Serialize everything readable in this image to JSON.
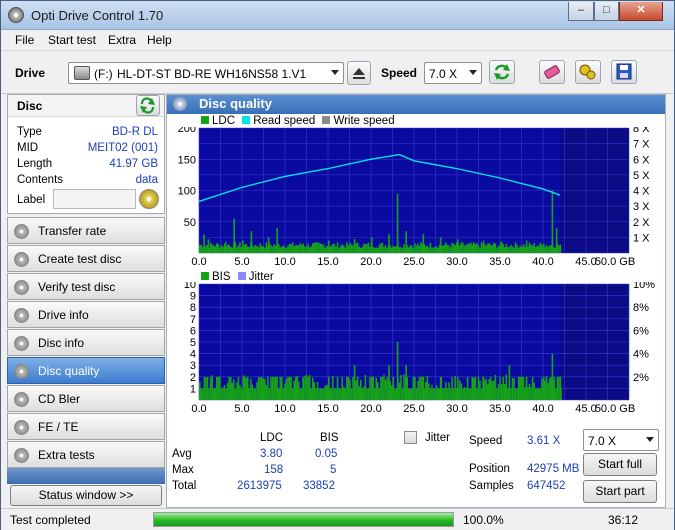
{
  "window": {
    "title": "Opti Drive Control 1.70",
    "min": "–",
    "max": "□",
    "close": "✕"
  },
  "menu": [
    "File",
    "Start test",
    "Extra",
    "Help"
  ],
  "toolbar": {
    "drive_label": "Drive",
    "drive_letter": "(F:)",
    "drive_name": "HL-DT-ST BD-RE  WH16NS58 1.V1",
    "speed_label": "Speed",
    "speed_value": "7.0 X"
  },
  "disc": {
    "title": "Disc",
    "type_label": "Type",
    "type": "BD-R DL",
    "mid_label": "MID",
    "mid": "MEIT02 (001)",
    "length_label": "Length",
    "length": "41.97 GB",
    "contents_label": "Contents",
    "contents": "data",
    "label_label": "Label",
    "label_value": ""
  },
  "nav": [
    "Transfer rate",
    "Create test disc",
    "Verify test disc",
    "Drive info",
    "Disc info",
    "Disc quality",
    "CD Bler",
    "FE / TE",
    "Extra tests"
  ],
  "status_window_button": "Status window >>",
  "panel": {
    "title": "Disc quality"
  },
  "legend_top": {
    "ldc": "LDC",
    "read": "Read speed",
    "write": "Write speed"
  },
  "legend_bottom": {
    "bis": "BIS",
    "jitter": "Jitter"
  },
  "colors": {
    "ldc": "#17a317",
    "read": "#00e5e5",
    "write": "#8a8a8a",
    "bis": "#17a317",
    "jitter": "#8a8aff",
    "plot_bg": "#0a0aa0",
    "accent": "#1c3fb5"
  },
  "chart_data": [
    {
      "type": "bar",
      "x_ticks": [
        "0.0",
        "5.0",
        "10.0",
        "15.0",
        "20.0",
        "25.0",
        "30.0",
        "35.0",
        "40.0",
        "45.0",
        "50.0 GB"
      ],
      "y_left_ticks": [
        "200",
        "150",
        "100",
        "50"
      ],
      "y_right_ticks": [
        "8 X",
        "7 X",
        "6 X",
        "5 X",
        "4 X",
        "3 X",
        "2 X",
        "1 X"
      ],
      "xlim": [
        0,
        50
      ],
      "ylim": [
        0,
        200
      ],
      "y2lim": [
        0,
        8
      ],
      "disc_end_gb": 42.0,
      "series": [
        {
          "name": "LDC",
          "values": [
            [
              0.5,
              30
            ],
            [
              1,
              22
            ],
            [
              3,
              18
            ],
            [
              4,
              55
            ],
            [
              5,
              20
            ],
            [
              6,
              35
            ],
            [
              8,
              25
            ],
            [
              9,
              40
            ],
            [
              12,
              15
            ],
            [
              15,
              20
            ],
            [
              18,
              22
            ],
            [
              20,
              25
            ],
            [
              22,
              30
            ],
            [
              23,
              95
            ],
            [
              24,
              35
            ],
            [
              26,
              30
            ],
            [
              28,
              25
            ],
            [
              30,
              22
            ],
            [
              33,
              20
            ],
            [
              35,
              18
            ],
            [
              38,
              20
            ],
            [
              40,
              15
            ],
            [
              41,
              100
            ],
            [
              41.5,
              40
            ]
          ]
        },
        {
          "name": "Read speed",
          "values": [
            [
              0,
              3.3
            ],
            [
              5,
              4.2
            ],
            [
              10,
              4.9
            ],
            [
              15,
              5.4
            ],
            [
              20,
              6.0
            ],
            [
              23.3,
              6.3
            ],
            [
              25,
              5.9
            ],
            [
              30,
              5.4
            ],
            [
              35,
              4.8
            ],
            [
              40,
              4.1
            ],
            [
              42,
              3.7
            ]
          ]
        }
      ]
    },
    {
      "type": "bar",
      "x_ticks": [
        "0.0",
        "5.0",
        "10.0",
        "15.0",
        "20.0",
        "25.0",
        "30.0",
        "35.0",
        "40.0",
        "45.0",
        "50.0 GB"
      ],
      "y_left_ticks": [
        "10",
        "9",
        "8",
        "7",
        "6",
        "5",
        "4",
        "3",
        "2",
        "1"
      ],
      "y_right_ticks": [
        "10%",
        "8%",
        "6%",
        "4%",
        "2%"
      ],
      "xlim": [
        0,
        50
      ],
      "ylim": [
        0,
        10
      ],
      "y2lim": [
        0,
        10
      ],
      "disc_end_gb": 42.0,
      "series": [
        {
          "name": "BIS",
          "values": [
            [
              0,
              1
            ],
            [
              5,
              1
            ],
            [
              10,
              1
            ],
            [
              12,
              2
            ],
            [
              15,
              2
            ],
            [
              18,
              3
            ],
            [
              20,
              2
            ],
            [
              22,
              3
            ],
            [
              23,
              5
            ],
            [
              24,
              3
            ],
            [
              26,
              2
            ],
            [
              28,
              2
            ],
            [
              30,
              2
            ],
            [
              33,
              2
            ],
            [
              36,
              3
            ],
            [
              38,
              2
            ],
            [
              40,
              2
            ],
            [
              41,
              4
            ],
            [
              42,
              1
            ]
          ]
        }
      ]
    }
  ],
  "stats": {
    "col_ldc": "LDC",
    "col_bis": "BIS",
    "avg_label": "Avg",
    "avg_ldc": "3.80",
    "avg_bis": "0.05",
    "max_label": "Max",
    "max_ldc": "158",
    "max_bis": "5",
    "total_label": "Total",
    "total_ldc": "2613975",
    "total_bis": "33852",
    "jitter_label": "Jitter",
    "speed_label": "Speed",
    "speed": "3.61 X",
    "speed_select": "7.0 X",
    "position_label": "Position",
    "position": "42975 MB",
    "samples_label": "Samples",
    "samples": "647452",
    "start_full": "Start full",
    "start_part": "Start part"
  },
  "status": {
    "text": "Test completed",
    "progress": "100.0%",
    "progress_fraction": 1.0,
    "time": "36:12"
  }
}
